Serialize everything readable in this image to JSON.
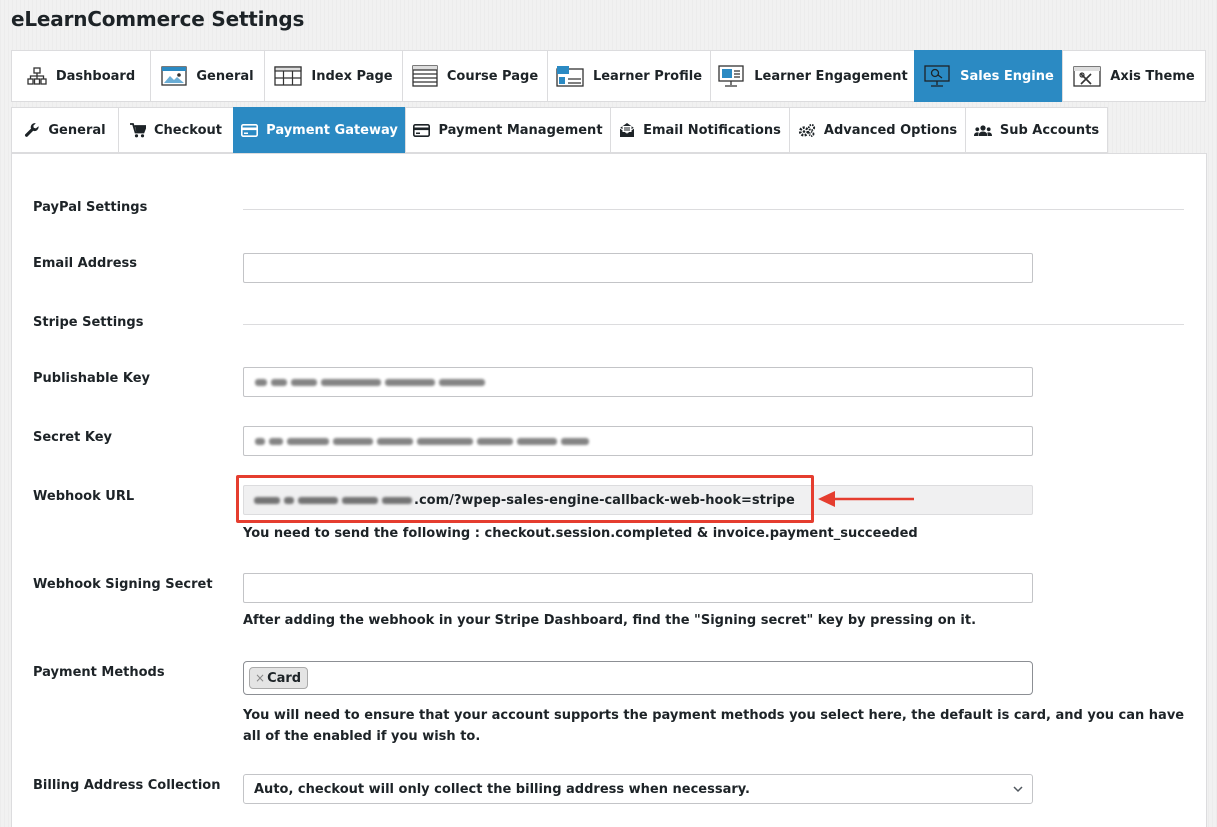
{
  "page": {
    "title": "eLearnCommerce Settings"
  },
  "main_tabs": [
    {
      "label": "Dashboard",
      "icon": "sitemap-icon"
    },
    {
      "label": "General",
      "icon": "window-image-icon"
    },
    {
      "label": "Index Page",
      "icon": "grid-layout-icon"
    },
    {
      "label": "Course Page",
      "icon": "list-layout-icon"
    },
    {
      "label": "Learner Profile",
      "icon": "profile-layout-icon"
    },
    {
      "label": "Learner Engagement",
      "icon": "monitor-icon"
    },
    {
      "label": "Sales Engine",
      "icon": "presentation-icon",
      "active": true
    },
    {
      "label": "Axis Theme",
      "icon": "theme-tools-icon"
    }
  ],
  "sub_tabs": [
    {
      "label": "General",
      "icon": "wrench-icon"
    },
    {
      "label": "Checkout",
      "icon": "cart-icon"
    },
    {
      "label": "Payment Gateway",
      "icon": "credit-card-icon",
      "active": true
    },
    {
      "label": "Payment Management",
      "icon": "credit-card-icon"
    },
    {
      "label": "Email Notifications",
      "icon": "envelope-open-icon"
    },
    {
      "label": "Advanced Options",
      "icon": "cogs-icon"
    },
    {
      "label": "Sub Accounts",
      "icon": "users-icon"
    }
  ],
  "form": {
    "paypal_heading": "PayPal Settings",
    "email_label": "Email Address",
    "email_value": "",
    "stripe_heading": "Stripe Settings",
    "publishable_label": "Publishable Key",
    "secret_label": "Secret Key",
    "webhook_label": "Webhook URL",
    "webhook_visible_suffix": ".com/?wpep-sales-engine-callback-web-hook=stripe",
    "webhook_help": "You need to send the following : checkout.session.completed & invoice.payment_succeeded",
    "signing_label": "Webhook Signing Secret",
    "signing_value": "",
    "signing_help": "After adding the webhook in your Stripe Dashboard, find the \"Signing secret\" key by pressing on it.",
    "methods_label": "Payment Methods",
    "methods_selected": [
      "Card"
    ],
    "methods_remove_glyph": "×",
    "methods_help": "You will need to ensure that your account supports the payment methods you select here, the default is card, and you can have all of the enabled if you wish to.",
    "billing_label": "Billing Address Collection",
    "billing_value": "Auto, checkout will only collect the billing address when necessary."
  },
  "colors": {
    "accent": "#2b8ac3",
    "highlight": "#e53d2f"
  }
}
